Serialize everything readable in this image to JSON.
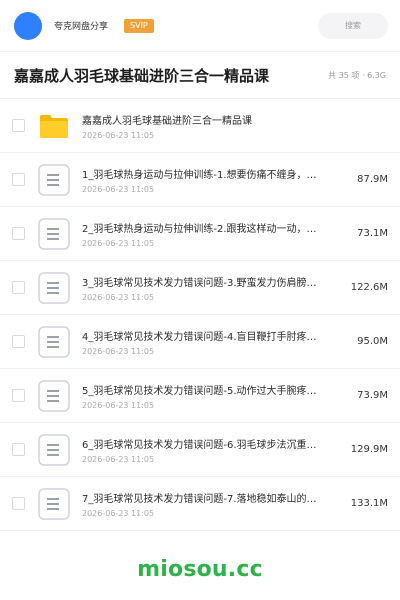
{
  "app": {
    "name": "夸克网盘分享",
    "badge": "SVIP",
    "search_placeholder": "搜索"
  },
  "header": {
    "title": "嘉嘉成人羽毛球基础进阶三合一精品课",
    "meta": "共 35 项 · 6.3G"
  },
  "items": [
    {
      "type": "folder",
      "name": "嘉嘉成人羽毛球基础进阶三合一精品课",
      "date": "2026-06-23 11:05",
      "size": ""
    },
    {
      "type": "file",
      "name": "1_羽毛球热身运动与拉伸训练-1.想要伤痛不缠身，…",
      "date": "2026-06-23 11:05",
      "size": "87.9M"
    },
    {
      "type": "file",
      "name": "2_羽毛球热身运动与拉伸训练-2.跟我这样动一动，…",
      "date": "2026-06-23 11:05",
      "size": "73.1M"
    },
    {
      "type": "file",
      "name": "3_羽毛球常见技术发力错误问题-3.野蛮发力伤肩膀…",
      "date": "2026-06-23 11:05",
      "size": "122.6M"
    },
    {
      "type": "file",
      "name": "4_羽毛球常见技术发力错误问题-4.盲目鞭打手肘疼…",
      "date": "2026-06-23 11:05",
      "size": "95.0M"
    },
    {
      "type": "file",
      "name": "5_羽毛球常见技术发力错误问题-5.动作过大手腕疼…",
      "date": "2026-06-23 11:05",
      "size": "73.9M"
    },
    {
      "type": "file",
      "name": "6_羽毛球常见技术发力错误问题-6.羽毛球步法沉重…",
      "date": "2026-06-23 11:05",
      "size": "129.9M"
    },
    {
      "type": "file",
      "name": "7_羽毛球常见技术发力错误问题-7.落地稳如泰山的…",
      "date": "2026-06-23 11:05",
      "size": "133.1M"
    }
  ],
  "footer": {
    "brand": "miosou.cc"
  },
  "colors": {
    "accent": "#2f80ff",
    "svip": "#f0a23a",
    "folder": "#f5b800",
    "footer": "#2fb24a"
  }
}
